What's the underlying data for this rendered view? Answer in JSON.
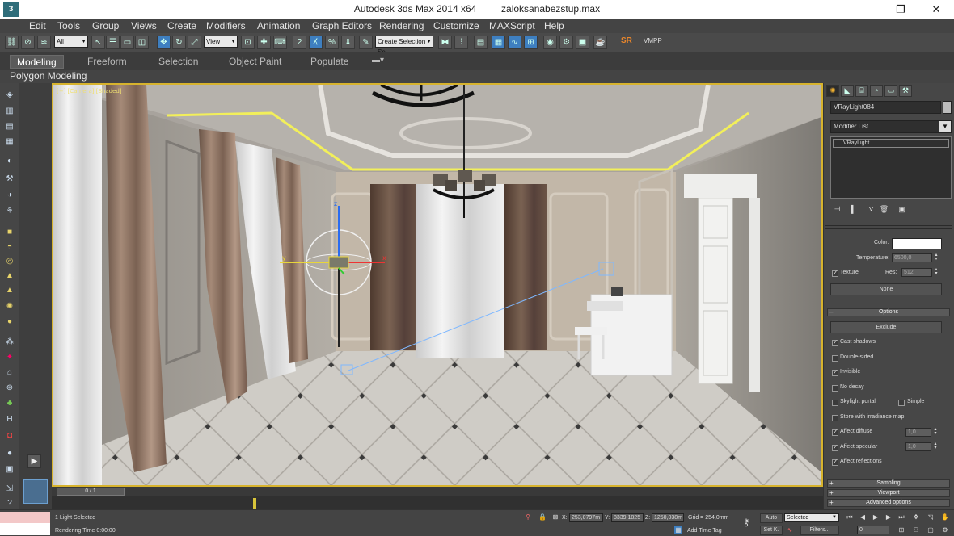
{
  "window": {
    "app_title": "Autodesk 3ds Max  2014 x64",
    "file_name": "zaloksanabezstup.max",
    "minimize_glyph": "—",
    "maximize_glyph": "❐",
    "close_glyph": "✕",
    "logo_glyph": "3"
  },
  "menu": [
    "Edit",
    "Tools",
    "Group",
    "Views",
    "Create",
    "Modifiers",
    "Animation",
    "Graph Editors",
    "Rendering",
    "Customize",
    "MAXScript",
    "Help"
  ],
  "toolbar": {
    "selection_filter": "All",
    "reference_coord": "View",
    "named_selection": "Create Selection Se",
    "sr_label": "SR",
    "vmpp_label": "VMPP",
    "icons": [
      "link-icon",
      "unlink-icon",
      "bind-spacewarp-icon",
      "select-icon",
      "select-by-name-icon",
      "rect-region-icon",
      "window-crossing-icon",
      "select-move-icon",
      "select-rotate-icon",
      "select-scale-icon",
      "pivot-center-icon",
      "select-manipulate-icon",
      "keyboard-shortcut-icon",
      "snap-2-5-icon",
      "angle-snap-icon",
      "percent-snap-icon",
      "spinner-snap-icon",
      "edit-named-sel-icon",
      "mirror-icon",
      "align-icon",
      "layer-manager-icon",
      "graphite-ribbon-icon",
      "curve-editor-icon",
      "schematic-view-icon",
      "material-editor-icon",
      "render-setup-icon",
      "rendered-frame-icon",
      "render-production-icon"
    ]
  },
  "ribbon": {
    "tabs": [
      "Modeling",
      "Freeform",
      "Selection",
      "Object Paint",
      "Populate"
    ],
    "active_tab": "Modeling",
    "subpanel": "Polygon Modeling"
  },
  "left_tools": [
    "vray-icon",
    "cube-icon",
    "sphere-icon",
    "light-icon",
    "camera-icon",
    "helper-icon",
    "spacewarp-icon",
    "system-icon",
    "teapot-icon",
    "plane-icon",
    "box-icon",
    "cone-icon",
    "torus-icon",
    "sun-icon",
    "geosphere-icon",
    "cylinder-icon",
    "tube-icon",
    "pyramid-icon",
    "grid-icon",
    "dome-icon",
    "plant-icon",
    "hair-icon",
    "particle-icon",
    "sphere-gizmo-icon",
    "scale-icon",
    "question-icon"
  ],
  "command_panel": {
    "tab_icons": [
      "sun-icon",
      "modify-icon",
      "hierarchy-icon",
      "motion-icon",
      "display-icon",
      "utilities-icon"
    ],
    "object_name": "VRayLight084",
    "modifier_list": "Modifier List",
    "stack_item": "VRayLight",
    "color_label": "Color:",
    "temperature_label": "Temperature:",
    "temperature_value": "6500,0",
    "texture_label": "Texture",
    "res_label": "Res:",
    "res_value": "512",
    "none_button": "None",
    "options_rollout": "Options",
    "exclude_button": "Exclude",
    "options": [
      {
        "label": "Cast shadows",
        "checked": true
      },
      {
        "label": "Double-sided",
        "checked": false
      },
      {
        "label": "Invisible",
        "checked": true
      },
      {
        "label": "No decay",
        "checked": false
      },
      {
        "label": "Skylight portal",
        "checked": false
      },
      {
        "label": "Store with irradiance map",
        "checked": false
      },
      {
        "label": "Affect diffuse",
        "checked": true
      },
      {
        "label": "Affect specular",
        "checked": true
      },
      {
        "label": "Affect reflections",
        "checked": true
      }
    ],
    "simple_label": "Simple",
    "affect_diffuse_value": "1,0",
    "affect_specular_value": "1,0",
    "sampling_rollout": "Sampling",
    "viewport_rollout": "Viewport",
    "advanced_rollout": "Advanced options"
  },
  "viewport": {
    "gizmo_x_label": "x",
    "gizmo_y_label": "y",
    "gizmo_z_label": "z",
    "overlay_text": "[+] [Camera] [Shaded]"
  },
  "timeline": {
    "slider_label": "0 / 1"
  },
  "statusbar": {
    "selection_status": "1 Light Selected",
    "rendering_time": "Rendering Time  0:00:00",
    "x_label": "X:",
    "x_value": "253,0797m",
    "y_label": "Y:",
    "y_value": "8339,1825",
    "z_label": "Z:",
    "z_value": "1250,038m",
    "grid_label": "Grid = 254,0mm",
    "add_time_tag": "Add Time Tag",
    "auto_label": "Auto",
    "set_key_label": "Set K.",
    "selected_dropdown": "Selected",
    "filters_label": "Filters...",
    "frame_value": "0"
  },
  "colors": {
    "accent": "#3e7fc0",
    "viewport_border": "#d7b32d",
    "light_color_swatch": "#ffffff"
  }
}
